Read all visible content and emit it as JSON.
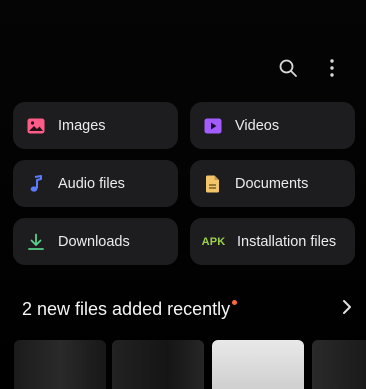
{
  "topbar": {
    "search_icon": "search-icon",
    "more_icon": "more-vertical-icon"
  },
  "categories": [
    {
      "label": "Images",
      "icon": "image-icon",
      "color": "#ff5c8a"
    },
    {
      "label": "Videos",
      "icon": "video-icon",
      "color": "#a35cff"
    },
    {
      "label": "Audio files",
      "icon": "music-note-icon",
      "color": "#5b7cff"
    },
    {
      "label": "Documents",
      "icon": "document-icon",
      "color": "#f2c56b"
    },
    {
      "label": "Downloads",
      "icon": "download-icon",
      "color": "#58d08a"
    },
    {
      "label": "Installation files",
      "icon": "apk-icon",
      "icon_text": "APK",
      "color": "#9bd14a"
    }
  ],
  "recent": {
    "title": "2 new files added recently",
    "chevron": "chevron-right-icon",
    "dot_color": "#ff6a3a"
  }
}
